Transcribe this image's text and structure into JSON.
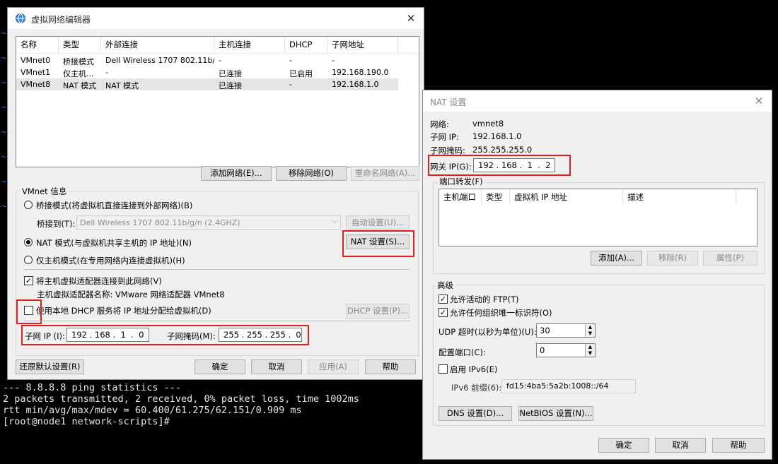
{
  "terminal": {
    "lines": [
      "--- 8.8.8.8 ping statistics ---",
      "2 packets transmitted, 2 received, 0% packet loss, time 1002ms",
      "rtt min/avg/max/mdev = 60.400/61.275/62.151/0.909 ms",
      "[root@node1 network-scripts]#"
    ]
  },
  "vne": {
    "title": "虚拟网络编辑器",
    "columns": [
      "名称",
      "类型",
      "外部连接",
      "主机连接",
      "DHCP",
      "子网地址"
    ],
    "rows": [
      [
        "VMnet0",
        "桥接模式",
        "Dell Wireless 1707 802.11b/...",
        "-",
        "-",
        "-"
      ],
      [
        "VMnet1",
        "仅主机...",
        "-",
        "已连接",
        "已启用",
        "192.168.190.0"
      ],
      [
        "VMnet8",
        "NAT 模式",
        "NAT 模式",
        "已连接",
        "-",
        "192.168.1.0"
      ]
    ],
    "add_network": "添加网络(E)...",
    "remove_network": "移除网络(O)",
    "rename_network": "重命名网络(A)...",
    "info_label": "VMnet 信息",
    "bridge_mode": "桥接模式(将虚拟机直接连接到外部网络)(B)",
    "bridge_to_label": "桥接到(T):",
    "bridge_to_value": "Dell Wireless 1707 802.11b/g/n (2.4GHZ)",
    "auto_settings": "自动设置(U)...",
    "nat_mode": "NAT 模式(与虚拟机共享主机的 IP 地址)(N)",
    "nat_settings": "NAT 设置(S)...",
    "host_only": "仅主机模式(在专用网络内连接虚拟机)(H)",
    "connect_adapter": "将主机虚拟适配器连接到此网络(V)",
    "adapter_name": "主机虚拟适配器名称: VMware 网络适配器 VMnet8",
    "use_dhcp": "使用本地 DHCP 服务将 IP 地址分配给虚拟机(D)",
    "dhcp_settings": "DHCP 设置(P)...",
    "subnet_ip_label": "子网 IP (I):",
    "subnet_ip": "192 . 168 .  1  .  0",
    "subnet_mask_label": "子网掩码(M):",
    "subnet_mask": "255 . 255 . 255 .  0",
    "restore": "还原默认设置(R)",
    "ok": "确定",
    "cancel": "取消",
    "apply": "应用(A)",
    "help": "帮助"
  },
  "nat": {
    "title": "NAT 设置",
    "network_label": "网络:",
    "network_value": "vmnet8",
    "subnet_ip_label": "子网 IP:",
    "subnet_ip_value": "192.168.1.0",
    "subnet_mask_label": "子网掩码:",
    "subnet_mask_value": "255.255.255.0",
    "gateway_label": "网关 IP(G):",
    "gateway_value": "192 . 168 .  1  .  2",
    "port_forward_label": "端口转发(F)",
    "pf_columns": [
      "主机端口",
      "类型",
      "虚拟机 IP 地址",
      "描述"
    ],
    "add": "添加(A)...",
    "remove": "移除(R)",
    "properties": "属性(P)",
    "advanced_label": "高级",
    "allow_ftp": "允许活动的 FTP(T)",
    "allow_oui": "允许任何组织唯一标识符(O)",
    "udp_timeout_label": "UDP 超时(以秒为单位)(U):",
    "udp_timeout_value": "30",
    "config_port_label": "配置端口(C):",
    "config_port_value": "0",
    "enable_ipv6": "启用 IPv6(E)",
    "ipv6_prefix_label": "IPv6 前缀(6):",
    "ipv6_prefix_value": "fd15:4ba5:5a2b:1008::/64",
    "dns_settings": "DNS 设置(D)...",
    "netbios_settings": "NetBIOS 设置(N)...",
    "ok": "确定",
    "cancel": "取消",
    "help": "帮助"
  },
  "icons": {
    "close": "close-icon",
    "app": "network-globe-icon",
    "check": "checkmark-icon",
    "dropdown": "chevron-down-icon"
  }
}
